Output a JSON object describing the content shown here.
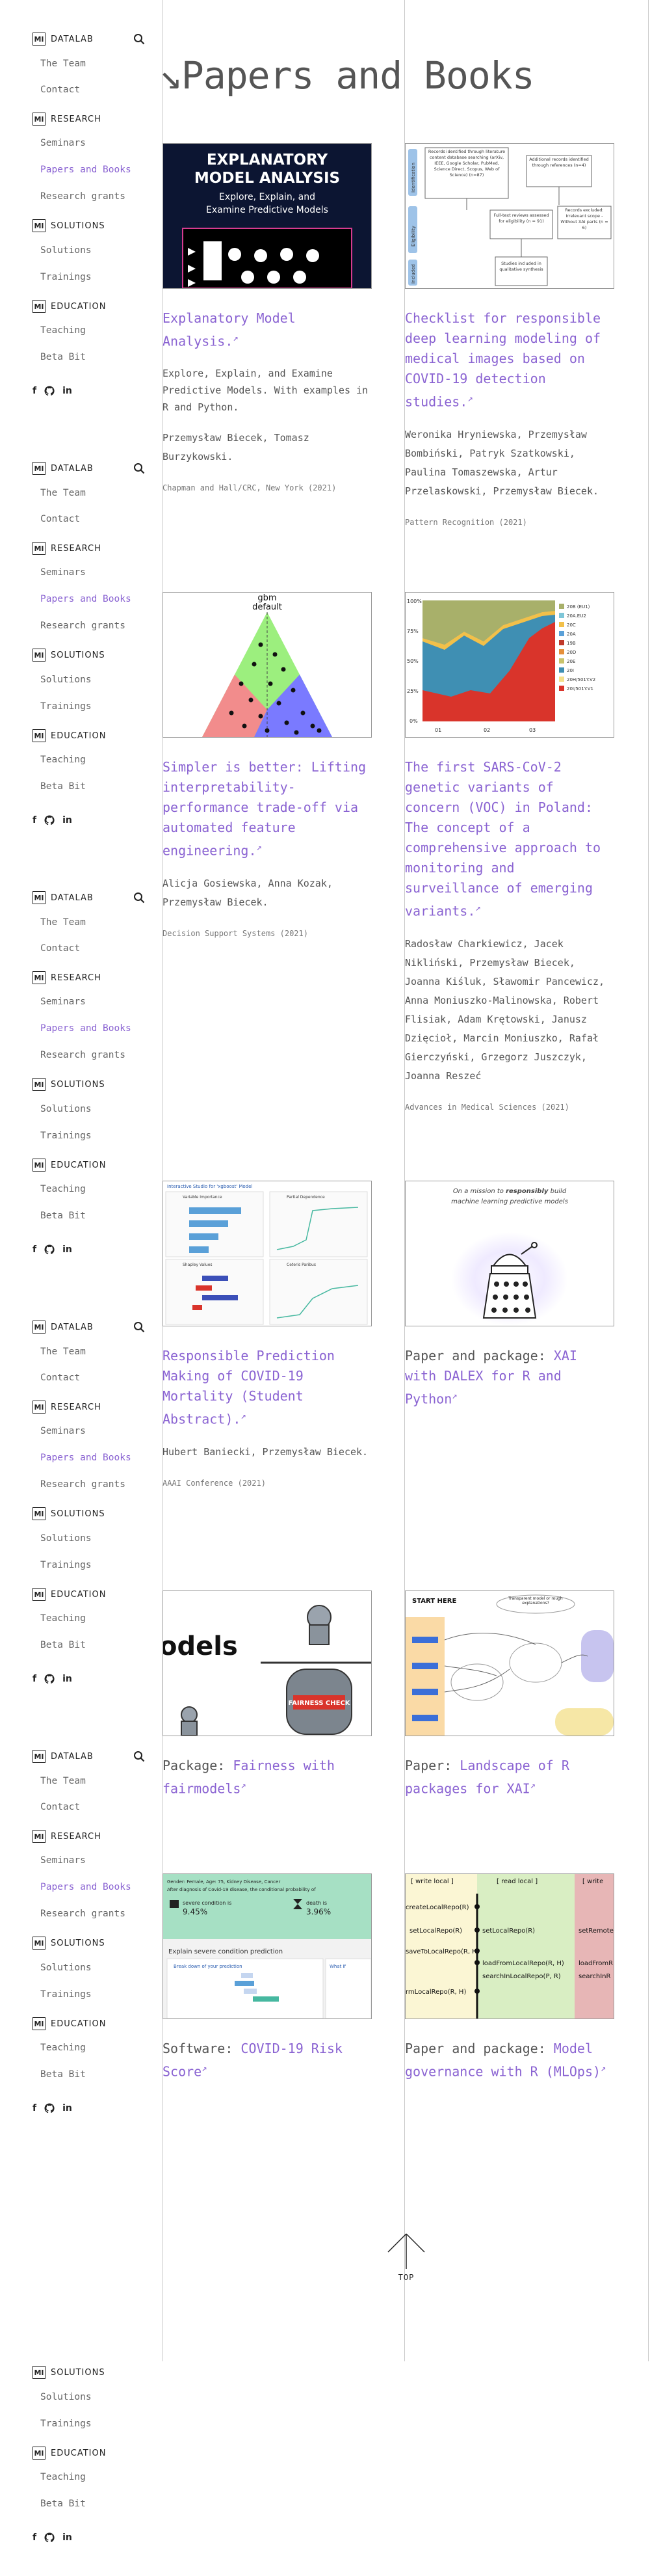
{
  "sidebar": {
    "datalab": "DATALAB",
    "research": "RESEARCH",
    "solutions": "SOLUTIONS",
    "education": "EDUCATION",
    "logo": "MI",
    "items": {
      "team": "The Team",
      "contact": "Contact",
      "seminars": "Seminars",
      "papers": "Papers and Books",
      "grants": "Research grants",
      "solutions": "Solutions",
      "trainings": "Trainings",
      "teaching": "Teaching",
      "betabit": "Beta Bit"
    },
    "social": [
      "f",
      "github",
      "in"
    ]
  },
  "page": {
    "title": "Papers and Books",
    "title_arrow": "↘"
  },
  "cards": [
    {
      "title": "Explanatory Model Analysis.",
      "desc": "Explore, Explain, and Examine Predictive Models. With examples in R and Python.",
      "authors": "Przemysław Biecek, Tomasz Burzykowski.",
      "pub": "Chapman and Hall/CRC, New York (2021)",
      "thumb": {
        "line1": "EXPLANATORY",
        "line2": "MODEL ANALYSIS",
        "line3": "Explore, Explain, and",
        "line4": "Examine Predictive Models"
      }
    },
    {
      "title": "Checklist for responsible deep learning modeling of medical images based on COVID-19 detection studies.",
      "authors": "Weronika Hryniewska, Przemysław Bombiński, Patryk Szatkowski, Paulina Tomaszewska, Artur Przelaskowski, Przemysław Biecek.",
      "pub": "Pattern Recognition (2021)",
      "thumb": {
        "side1": "Identification",
        "side2": "Eligibility",
        "side3": "Included",
        "box1": "Records identified through literature content database searching (arXiv, IEEE, Google Scholar, PubMed, Science Direct, Scopus, Web of Science) (n=87)",
        "box2": "Additional records identified through references (n=4)",
        "box3": "Full-text reviews assessed for eligibility (n = 91)",
        "box4": "Records excluded: Irrelevant scope - Without XAI parts (n = 6)",
        "box5": "Studies included in qualitative synthesis"
      }
    },
    {
      "title": "Simpler is better: Lifting interpretability-performance trade-off via automated feature engineering.",
      "authors": "Alicja Gosiewska, Anna Kozak, Przemysław Biecek.",
      "pub": "Decision Support Systems (2021)",
      "thumb": {
        "label1": "gbm",
        "label2": "default"
      }
    },
    {
      "title": "The first SARS-CoV-2 genetic variants of concern (VOC) in Poland: The concept of a comprehensive approach to monitoring and surveillance of emerging variants.",
      "authors": "Radosław Charkiewicz, Jacek Nikliński, Przemysław Biecek, Joanna Kiśluk, Sławomir Pancewicz, Anna Moniuszko-Malinowska, Robert Flisiak, Adam Krętowski, Janusz Dzięcioł, Marcin Moniuszko, Rafał Gierczyński, Grzegorz Juszczyk, Joanna Reszeć",
      "pub": "Advances in Medical Sciences (2021)",
      "thumb": {
        "yticks": [
          "100%",
          "75%",
          "50%",
          "25%",
          "0%"
        ],
        "xticks": [
          "01",
          "02",
          "03"
        ],
        "legend": [
          "20B (EU1)",
          "20A.EU2",
          "20C",
          "20A",
          "19B",
          "20D",
          "20E",
          "20I",
          "20H/501Y.V2",
          "20I/501Y.V1"
        ]
      }
    },
    {
      "title": "Responsible Prediction Making of COVID-19 Mortality (Student Abstract).",
      "authors": "Hubert Baniecki, Przemysław Biecek.",
      "pub": "AAAI Conference (2021)",
      "thumb": {
        "heading": "Interactive Studio for 'xgboost' Model",
        "panel1": "Variable Importance",
        "panel2": "Partial Dependence",
        "panel3": "Shapley Values",
        "panel4": "Ceteris Paribus"
      }
    },
    {
      "prefix": "Paper and package:",
      "title": "XAI with DALEX for R and Python",
      "thumb": {
        "line1": "On a mission to",
        "bold": "responsibly",
        "line1b": "build",
        "line2": "machine learning predictive models"
      }
    },
    {
      "prefix": "Package:",
      "title": "Fairness with fairmodels",
      "thumb": {
        "word": "odels",
        "banner": "FAIRNESS CHECK"
      }
    },
    {
      "prefix": "Paper:",
      "title": "Landscape of R packages for XAI",
      "thumb": {
        "start": "START HERE",
        "bubble": "Transparent model or rough explanations?"
      }
    },
    {
      "prefix": "Software:",
      "title": "COVID-19 Risk Score",
      "thumb": {
        "header": "Gender: Female, Age: 75, Kidney Disease, Cancer",
        "sub": "After diagnosis of Covid-19 disease, the conditional probability of",
        "label1": "severe condition is",
        "val1": "9.45%",
        "label2": "death is",
        "val2": "3.96%",
        "explain": "Explain severe condition prediction",
        "breakdown": "Break down of your prediction",
        "whatif": "What if"
      }
    },
    {
      "prefix": "Paper and package:",
      "title": "Model governance with R (MLOps)",
      "thumb": {
        "col1": "[ write local ]",
        "col2": "[ read local ]",
        "col3": "[ write",
        "left": [
          "createLocalRepo(R)",
          "setLocalRepo(R)",
          "saveToLocalRepo(R, H)",
          "rmLocalRepo(R, H)"
        ],
        "mid": [
          "setLocalRepo(R)",
          "loadFromLocalRepo(R, H)",
          "searchInLocalRepo(P, R)"
        ],
        "right": [
          "setRemote",
          "loadFromR",
          "searchInR"
        ]
      }
    }
  ],
  "top_button": {
    "label": "TOP"
  },
  "colors": {
    "accent": "#8a63d2",
    "text": "#555555",
    "rule": "#c8c8c8"
  }
}
